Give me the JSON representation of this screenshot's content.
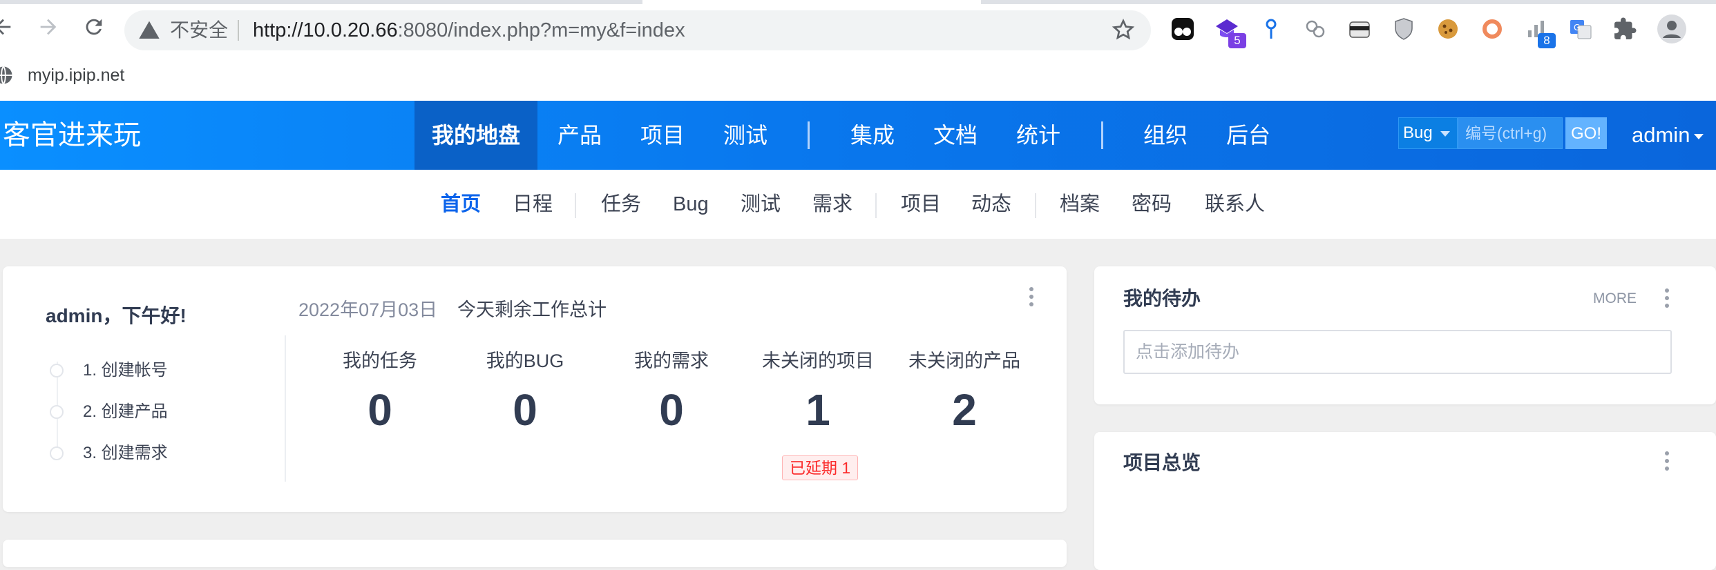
{
  "browser": {
    "insecure_label": "不安全",
    "url_host": "http://10.0.20.66",
    "url_rest": ":8080/index.php?m=my&f=index",
    "bookmarks": [
      {
        "label": "myip.ipip.net"
      }
    ],
    "extensions": [
      {
        "icon": "tampermonkey-icon",
        "badge": null
      },
      {
        "icon": "graduation-cap-icon",
        "badge": "5",
        "badge_color": "#7b3fe4"
      },
      {
        "icon": "pin-icon",
        "badge": null
      },
      {
        "icon": "circles-icon",
        "badge": null
      },
      {
        "icon": "mask-icon",
        "badge": null
      },
      {
        "icon": "shield-icon",
        "badge": null
      },
      {
        "icon": "cookie-icon",
        "badge": null
      },
      {
        "icon": "ring-icon",
        "badge": null
      },
      {
        "icon": "signal-bars-icon",
        "badge": "8",
        "badge_color": "#1a73e8"
      },
      {
        "icon": "translate-icon",
        "badge": null
      },
      {
        "icon": "puzzle-icon",
        "badge": null
      },
      {
        "icon": "profile-icon",
        "badge": null
      }
    ]
  },
  "header": {
    "brand": "客官进来玩",
    "nav_group_1": [
      "我的地盘",
      "产品",
      "项目",
      "测试"
    ],
    "nav_group_2": [
      "集成",
      "文档",
      "统计"
    ],
    "nav_group_3": [
      "组织",
      "后台"
    ],
    "search_type": "Bug",
    "search_placeholder": "编号(ctrl+g)",
    "search_go": "GO!",
    "user": "admin"
  },
  "subnav": {
    "group_1": [
      "首页",
      "日程"
    ],
    "group_2": [
      "任务",
      "Bug",
      "测试",
      "需求"
    ],
    "group_3": [
      "项目",
      "动态"
    ],
    "group_4": [
      "档案",
      "密码",
      "联系人"
    ]
  },
  "welcome": {
    "greeting": "admin，下午好!",
    "steps": [
      "1. 创建帐号",
      "2. 创建产品",
      "3. 创建需求"
    ],
    "date": "2022年07月03日",
    "summary_label": "今天剩余工作总计",
    "stats": [
      {
        "label": "我的任务",
        "value": "0"
      },
      {
        "label": "我的BUG",
        "value": "0"
      },
      {
        "label": "我的需求",
        "value": "0"
      },
      {
        "label": "未关闭的项目",
        "value": "1"
      },
      {
        "label": "未关闭的产品",
        "value": "2"
      }
    ],
    "delayed_badge": "已延期 1"
  },
  "todo": {
    "title": "我的待办",
    "more": "MORE",
    "placeholder": "点击添加待办"
  },
  "project_overview": {
    "title": "项目总览"
  },
  "colors": {
    "header_blue": "#0978ee",
    "header_active": "#0a61c7",
    "subnav_active": "#0c64eb",
    "delay_red": "#fb2b2b"
  }
}
